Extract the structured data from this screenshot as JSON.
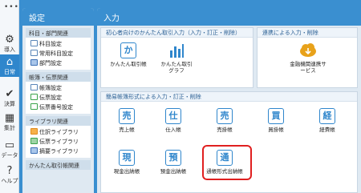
{
  "rail": {
    "items": [
      {
        "label": "導入",
        "icon": "gear-icon"
      },
      {
        "label": "日常",
        "icon": "home-icon"
      },
      {
        "label": "決算",
        "icon": "check-icon"
      },
      {
        "label": "集計",
        "icon": "table-icon"
      },
      {
        "label": "データ",
        "icon": "folder-icon"
      },
      {
        "label": "ヘルプ",
        "icon": "question-icon"
      }
    ]
  },
  "settings": {
    "title": "設定",
    "groups": [
      {
        "title": "科目・部門関連",
        "items": [
          "科目設定",
          "常用科目設定",
          "部門設定"
        ]
      },
      {
        "title": "帳簿・伝票関連",
        "items": [
          "帳簿設定",
          "伝票設定",
          "伝票番号設定"
        ]
      },
      {
        "title": "ライブラリ関連",
        "items": [
          "仕訳ライブラリ",
          "伝票ライブラリ",
          "摘要ライブラリ"
        ]
      },
      {
        "title": "かんたん取引帳関連",
        "items": []
      }
    ]
  },
  "main": {
    "title": "入力",
    "beginner": {
      "title": "初心者向けのかんたん取引入力（入力・訂正・削除）",
      "tiles": [
        {
          "glyph": "か",
          "label": "かんたん取引帳"
        },
        {
          "glyph": "",
          "label": "かんたん取引グラフ"
        }
      ]
    },
    "linked": {
      "title": "連携による入力・削除",
      "tiles": [
        {
          "glyph": "",
          "label": "金融機関連携サービス"
        }
      ]
    },
    "books": {
      "title": "簡易帳簿形式による入力・訂正・削除",
      "tiles": [
        {
          "glyph": "売",
          "label": "売上帳"
        },
        {
          "glyph": "仕",
          "label": "仕入帳"
        },
        {
          "glyph": "売",
          "label": "売掛帳"
        },
        {
          "glyph": "買",
          "label": "買掛帳"
        },
        {
          "glyph": "経",
          "label": "経費帳"
        },
        {
          "glyph": "現",
          "label": "現金出納帳"
        },
        {
          "glyph": "預",
          "label": "預金出納帳"
        },
        {
          "glyph": "通",
          "label": "通帳形式出納帳"
        }
      ]
    }
  },
  "colors": {
    "accent": "#2f86cc",
    "highlight": "#e02020",
    "cloud": "#e8a21a"
  }
}
